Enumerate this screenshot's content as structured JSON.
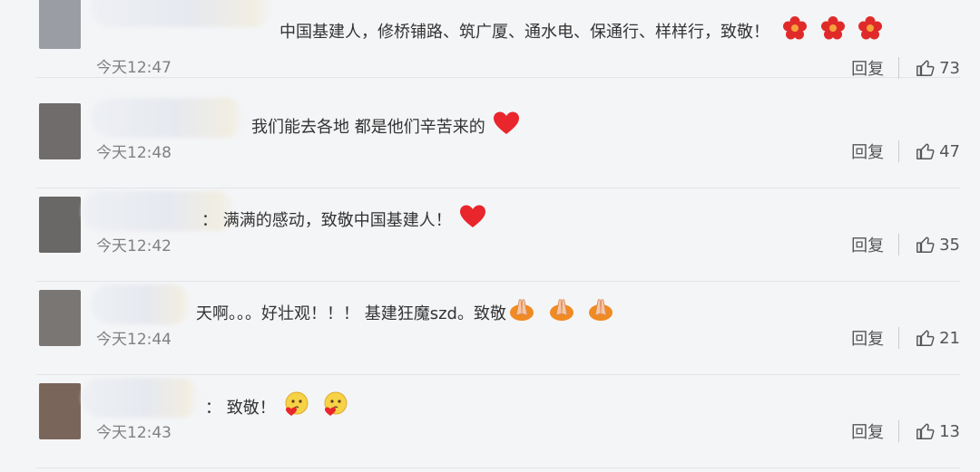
{
  "comments": [
    {
      "text": "中国基建人，修桥铺路、筑广厦、通水电、保通行、样样行，致敬！",
      "time": "今天12:47",
      "reply": "回复",
      "likes": "73",
      "emoji": [
        "flower-icon",
        "flower-icon",
        "flower-icon"
      ]
    },
    {
      "text": "我们能去各地 都是他们辛苦来的",
      "time": "今天12:48",
      "reply": "回复",
      "likes": "47",
      "emoji": [
        "red-heart-icon"
      ]
    },
    {
      "text": "：  满满的感动，致敬中国基建人！",
      "time": "今天12:42",
      "reply": "回复",
      "likes": "35",
      "emoji": [
        "red-heart-icon"
      ]
    },
    {
      "text": "天啊。。。好壮观！！！ 基建狂魔szd。致敬",
      "time": "今天12:44",
      "reply": "回复",
      "likes": "21",
      "emoji": [
        "praying-hands-icon",
        "praying-hands-icon",
        "praying-hands-icon"
      ]
    },
    {
      "text": "：  致敬！",
      "time": "今天12:43",
      "reply": "回复",
      "likes": "13",
      "emoji": [
        "heart-kiss-face-icon",
        "heart-kiss-face-icon"
      ]
    }
  ],
  "colors": {
    "background": "#f4f5f7",
    "text": "#333333",
    "muted": "#808080",
    "heart": "#e8262c"
  }
}
